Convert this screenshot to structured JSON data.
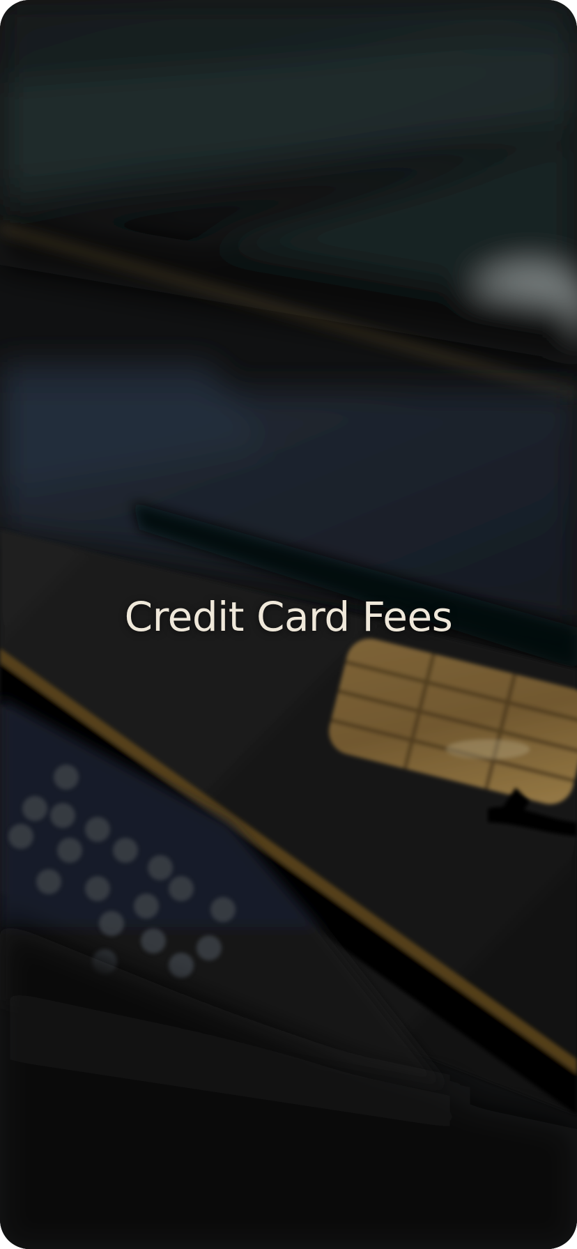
{
  "screen": {
    "title": "Credit Card Fees",
    "background_image": "blurred-credit-cards-photo",
    "title_color": "#efe8da"
  }
}
